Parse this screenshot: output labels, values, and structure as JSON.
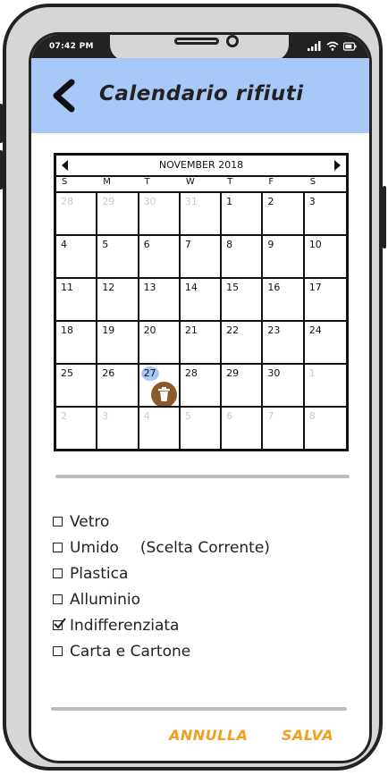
{
  "status_bar": {
    "time": "07:42 PM"
  },
  "header": {
    "title": "Calendario rifiuti",
    "back_icon": "chevron-left-icon"
  },
  "calendar": {
    "month_label": "NOVEMBER 2018",
    "weekdays": [
      "S",
      "M",
      "T",
      "W",
      "T",
      "F",
      "S"
    ],
    "weeks": [
      [
        {
          "d": "28",
          "m": true
        },
        {
          "d": "29",
          "m": true
        },
        {
          "d": "30",
          "m": true
        },
        {
          "d": "31",
          "m": true
        },
        {
          "d": "1",
          "m": false
        },
        {
          "d": "2",
          "m": false
        },
        {
          "d": "3",
          "m": false
        }
      ],
      [
        {
          "d": "4",
          "m": false
        },
        {
          "d": "5",
          "m": false
        },
        {
          "d": "6",
          "m": false
        },
        {
          "d": "7",
          "m": false
        },
        {
          "d": "8",
          "m": false
        },
        {
          "d": "9",
          "m": false
        },
        {
          "d": "10",
          "m": false
        }
      ],
      [
        {
          "d": "11",
          "m": false
        },
        {
          "d": "12",
          "m": false
        },
        {
          "d": "13",
          "m": false
        },
        {
          "d": "14",
          "m": false
        },
        {
          "d": "15",
          "m": false
        },
        {
          "d": "16",
          "m": false
        },
        {
          "d": "17",
          "m": false
        }
      ],
      [
        {
          "d": "18",
          "m": false
        },
        {
          "d": "19",
          "m": false
        },
        {
          "d": "20",
          "m": false
        },
        {
          "d": "21",
          "m": false
        },
        {
          "d": "22",
          "m": false
        },
        {
          "d": "23",
          "m": false
        },
        {
          "d": "24",
          "m": false
        }
      ],
      [
        {
          "d": "25",
          "m": false
        },
        {
          "d": "26",
          "m": false
        },
        {
          "d": "27",
          "m": false,
          "today": true,
          "marker": true
        },
        {
          "d": "28",
          "m": false
        },
        {
          "d": "29",
          "m": false
        },
        {
          "d": "30",
          "m": false
        },
        {
          "d": "1",
          "m": true
        }
      ],
      [
        {
          "d": "2",
          "m": true
        },
        {
          "d": "3",
          "m": true
        },
        {
          "d": "4",
          "m": true
        },
        {
          "d": "5",
          "m": true
        },
        {
          "d": "6",
          "m": true
        },
        {
          "d": "7",
          "m": true
        },
        {
          "d": "8",
          "m": true
        }
      ]
    ],
    "marker_icon": "trash-can-icon"
  },
  "waste_options": [
    {
      "label": "Vetro",
      "checked": false,
      "note": ""
    },
    {
      "label": "Umido",
      "checked": false,
      "note": "(Scelta Corrente)"
    },
    {
      "label": "Plastica",
      "checked": false,
      "note": ""
    },
    {
      "label": "Alluminio",
      "checked": false,
      "note": ""
    },
    {
      "label": "Indifferenziata",
      "checked": true,
      "note": ""
    },
    {
      "label": "Carta e Cartone",
      "checked": false,
      "note": ""
    }
  ],
  "footer": {
    "cancel_label": "ANNULLA",
    "save_label": "SALVA"
  },
  "colors": {
    "header_bg": "#a8c8f8",
    "accent": "#f0a020",
    "marker": "#8b5a2b",
    "today": "#a8c8f8"
  }
}
